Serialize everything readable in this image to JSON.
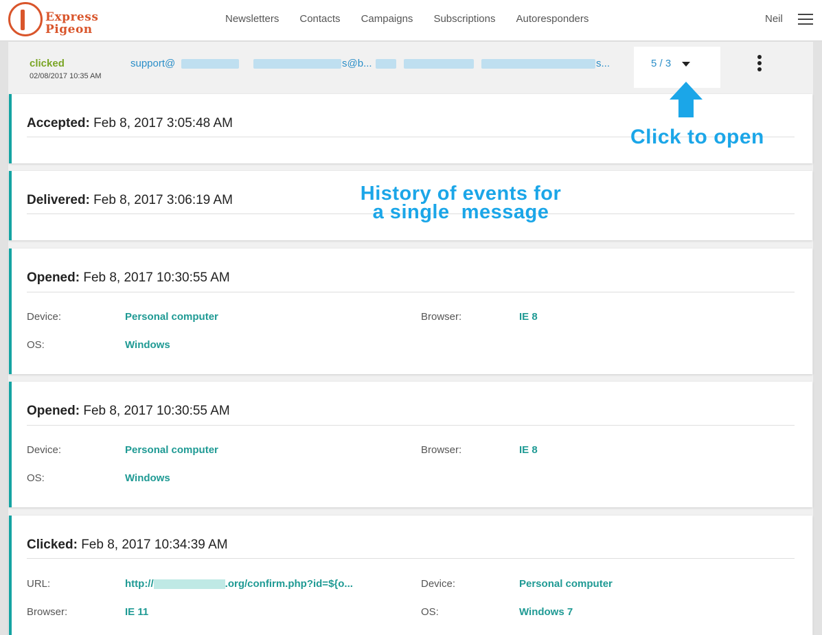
{
  "nav": {
    "logo_line1": "Express",
    "logo_line2": "Pigeon",
    "items": [
      "Newsletters",
      "Contacts",
      "Campaigns",
      "Subscriptions",
      "Autoresponders"
    ],
    "user": "Neil"
  },
  "message_row": {
    "status": "clicked",
    "date": "02/08/2017 10:35 AM",
    "from": "support@",
    "to_tail": "s@b...",
    "subject_tail": "s...",
    "counter": "5 / 3"
  },
  "events": [
    {
      "title_label": "Accepted:",
      "title_value": "Feb 8, 2017 3:05:48 AM"
    },
    {
      "title_label": "Delivered:",
      "title_value": "Feb 8, 2017 3:06:19 AM"
    },
    {
      "title_label": "Opened:",
      "title_value": "Feb 8, 2017 10:30:55 AM",
      "device_label": "Device:",
      "device": "Personal computer",
      "browser_label": "Browser:",
      "browser": "IE 8",
      "os_label": "OS:",
      "os": "Windows"
    },
    {
      "title_label": "Opened:",
      "title_value": "Feb 8, 2017 10:30:55 AM",
      "device_label": "Device:",
      "device": "Personal computer",
      "browser_label": "Browser:",
      "browser": "IE 8",
      "os_label": "OS:",
      "os": "Windows"
    },
    {
      "title_label": "Clicked:",
      "title_value": "Feb 8, 2017 10:34:39 AM",
      "url_label": "URL:",
      "url_prefix": "http://",
      "url_suffix": ".org/confirm.php?id=${o...",
      "device_label": "Device:",
      "device": "Personal computer",
      "browser_label": "Browser:",
      "browser": "IE 11",
      "os_label": "OS:",
      "os": "Windows 7"
    }
  ],
  "annotations": {
    "open_hint": "Click to open",
    "history_line1": "History of events for",
    "history_line2": "a single  message",
    "color": "#1ba6e8"
  },
  "colors": {
    "brand": "#d9552b",
    "link": "#2a8ec8",
    "accent_teal": "#1f9a94",
    "status_green": "#7aa525"
  }
}
